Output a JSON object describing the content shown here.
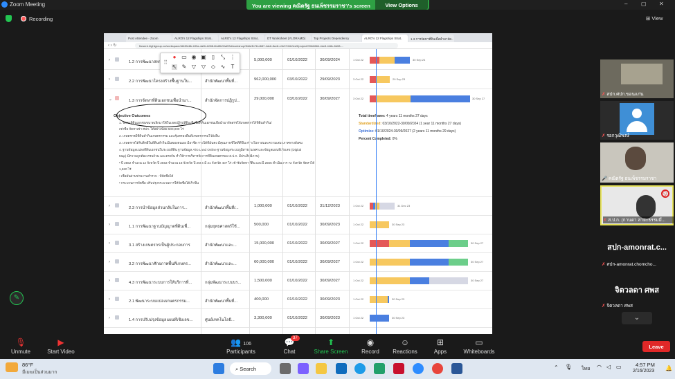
{
  "window": {
    "title": "Zoom Meeting",
    "minimize": "–",
    "maximize": "▢",
    "close": "✕"
  },
  "banner": {
    "message": "You are viewing คณิตรัฐ ธนเพ็ชรรมราชา's screen",
    "button": "View Options"
  },
  "meeting": {
    "recording": "Recording",
    "view": "View"
  },
  "browser": {
    "tabs": [
      "Post Attendee - Zoom",
      "ALRO's 12 Flagships Strat..",
      "ALRO's 12 Flagships Strat..",
      "DT Worksheet (YLORAMD)",
      "Top Projects Dependency",
      "ALRO's 12 Flagships Strat..",
      "1.3 การจัดหาที่ดินเพื่อนำมาจัด.."
    ],
    "url": "flowerd.hightgroup.co/workspace/dbf45e8b-b93a-4a0b-b088-6bd5b00af03d/workshop/3b8e3b78-d687-4dc6-8ce8-e1b3741b0ee9/project/09fe8664-4dc5-448c-8d08-..."
  },
  "rows_top": [
    {
      "name": "1.2 การพัฒนาสหกรณ์...",
      "org": "",
      "budget": "5,000,000",
      "start": "01/10/2022",
      "end": "30/09/2024",
      "gl": "1 Oct 22",
      "gr": "30 Sep 24"
    },
    {
      "name": "2.2 การพัฒนาโครงสร้างพื้นฐานใน...",
      "org": "สำนักพัฒนาพื้นที่...",
      "budget": "962,000,000",
      "start": "03/10/2022",
      "end": "29/09/2023",
      "gl": "3 Oct 22",
      "gr": "29 Sep 23"
    },
    {
      "name": "1.3 การจัดหาที่ดินเอกชนเพื่อนำมา...",
      "org": "สำนักจัดการปฏิรูป...",
      "budget": "29,000,000",
      "start": "03/10/2022",
      "end": "30/09/2027",
      "gl": "3 Oct 22",
      "gr": "30 Sep 27"
    }
  ],
  "objective": {
    "heading": "Objective Outcomes",
    "items": [
      "1. จัดหาที่ดินเอกชนขนาดเล็กมาใช้ในเขตปฏิรูปที่ดินเพื่อซื้อที่ดินเอกชนเพื่อนำมาจัดสรรให้เกษตรกรไร้ที่ดินทำกิน/",
      "เช่าซื้อ จัดหาเช่า ศปก. ได้อย่างน้อย 500,000 ไร่",
      "2. เกษตรกรมีที่ดินทำกินเกษตรกรรม และคุ้มครองพื้นที่เกษตรกรรมไว้ยั่งยืน",
      "3. เกษตรกรได้รับสิทธิในที่ดินทำกินเป็นของตนเอง มีอาชีพ รายได้ที่มั่นคง มีคุณภาพชีวิตที่ดีขึ้น สร้างโอกาสและความเสมอภาคทางสังคม",
      "4. ฐานข้อมูลแปลงที่ดินเอกชนในระบบที่ดิน ฐานข้อมูล Alro Land Online ฐานข้อมูลระบบภูมิสารสนเทศ และข้อมูลแผนที่เชิงเลข (Digital",
      "Map) มีความถูกต้อง ครบถ้วน และตรงกัน ทำให้การบริหารจัดการที่ดินเกษตรของ ส.ป.ก. มีประสิทธิภาพ)",
      "• ปี 2562 จำนวน 12 จังหวัด ปี 2563 จำนวน 18 จังหวัด ปี 2564 มี 21 จังหวัด 407 ไร่ เข้ารับจัดหาที่ดิน และปี 2565 ดำเนินการ 72 จังหวัด จัดหาได้",
      "1,620 ไร่",
      "• เชื่อมั่นผ่านข่ายงานสำรวจ - ที่จัดซื้อได้",
      "• กระบวนการจัดซื้อ ปรับปรุงกระบวนการให้จัดซื้อได้เร็วขึ้น"
    ],
    "total_label": "Total timeframe:",
    "total_value": "4 years 11 months 27 days",
    "standardized_label": "Standardized:",
    "standardized_value": "03/10/2022-30/09/2024 (1 year 11 months 27 days)",
    "optimize_label": "Optimize:",
    "optimize_value": "01/10/2024-30/09/2027 (2 years 11 months 29 days)",
    "percent_label": "Percent Completed:",
    "percent_value": "0%"
  },
  "rows_bottom": [
    {
      "name": "2.3 การนำข้อมูลส่วนกลับในการ...",
      "org": "สำนักพัฒนาพื้นที่/...",
      "budget": "1,000,000",
      "start": "01/10/2022",
      "end": "31/12/2023",
      "gl": "1 Oct 22",
      "gr": "31 Dec 23"
    },
    {
      "name": "1.1 การพัฒนาฐานบัญญาตที่ดินเพื่...",
      "org": "กลุ่มยุทธศาสตร์ใช้...",
      "budget": "500,000",
      "start": "01/10/2022",
      "end": "30/09/2023",
      "gl": "1 Oct 22",
      "gr": "30 Sep 23"
    },
    {
      "name": "3.1 สร้างเกษตรกรเป็นผู้ประกอบการ",
      "org": "สำนักพัฒนาและ...",
      "budget": "15,000,000",
      "start": "01/10/2022",
      "end": "30/09/2027",
      "gl": "1 Oct 22",
      "gr": "30 Sep 27"
    },
    {
      "name": "3.2 การพัฒนาศักยภาพพื้นที่เกษตร...",
      "org": "สำนักพัฒนาและ...",
      "budget": "60,000,000",
      "start": "01/10/2022",
      "end": "30/09/2027",
      "gl": "1 Oct 22",
      "gr": "30 Sep 27"
    },
    {
      "name": "4.3 การพัฒนาระบบการให้บริการที่...",
      "org": "กลุ่มพัฒนาระบบบร...",
      "budget": "1,500,000",
      "start": "01/10/2022",
      "end": "30/09/2027",
      "gl": "1 Oct 22",
      "gr": "30 Sep 27"
    },
    {
      "name": "2.1 พัฒนาระบบแปลงเกษตรกรรม...",
      "org": "สำนักพัฒนาพื้นที่...",
      "budget": "400,000",
      "start": "01/10/2022",
      "end": "30/09/2023",
      "gl": "1 Oct 22",
      "gr": "30 Sep 23"
    },
    {
      "name": "1.4 การปรับปรุงข้อมูลแผนที่เชิงเลข...",
      "org": "ศูนย์เทคโนโลยี...",
      "budget": "3,300,000",
      "start": "01/10/2022",
      "end": "30/09/2023",
      "gl": "1 Oct 22",
      "gr": "30 Sep 23"
    }
  ],
  "participants_panel": [
    {
      "name": "สปก.ศปก.ขอนแก่น"
    },
    {
      "name": "รอกวุฒิพงษ์"
    },
    {
      "name": "คณิตรัฐ ธนเพ็ชรรมราชา"
    },
    {
      "name": "ส.ป.ก. (กานดา สายะธรรมมี..."
    },
    {
      "big": "สปก-amonrat.c...",
      "name": "สปก-amonrat.chomcho..."
    },
    {
      "big": "จิตวลดา ศพส",
      "name": "จิตวลดา ศพส"
    }
  ],
  "toolbar": {
    "unmute": "Unmute",
    "video": "Start Video",
    "participants": "Participants",
    "participants_count": "106",
    "chat": "Chat",
    "chat_badge": "37",
    "share": "Share Screen",
    "record": "Record",
    "reactions": "Reactions",
    "apps": "Apps",
    "whiteboards": "Whiteboards",
    "leave": "Leave"
  },
  "taskbar": {
    "temp": "86°F",
    "weather": "มีเมฆเป็นส่วนมาก",
    "search": "Search",
    "lang": "ไทย",
    "time": "4:57 PM",
    "date": "2/16/2023"
  }
}
